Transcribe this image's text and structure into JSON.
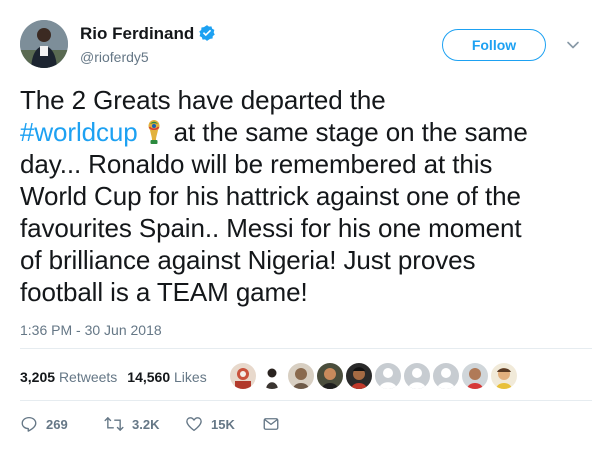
{
  "author": {
    "name": "Rio Ferdinand",
    "handle": "@rioferdy5",
    "verified": true
  },
  "follow_button": {
    "label": "Follow"
  },
  "tweet": {
    "lines": {
      "l1": "The 2 Greats have departed the",
      "l2_hashtag": "#worldcup",
      "l2_rest": "at the same stage on the same",
      "l3": "day... Ronaldo will be remembered at this",
      "l4": "World Cup for his hattrick against one of the",
      "l5": "favourites Spain.. Messi for his one moment",
      "l6": "of brilliance against Nigeria! Just proves",
      "l7": "football is a TEAM game!"
    },
    "timestamp": "1:36 PM - 30 Jun 2018"
  },
  "stats": {
    "retweets_count": "3,205",
    "retweets_label": "Retweets",
    "likes_count": "14,560",
    "likes_label": "Likes"
  },
  "actions": {
    "reply_count": "269",
    "retweet_count": "3.2K",
    "like_count": "15K"
  },
  "colors": {
    "accent": "#1da1f2",
    "muted_text": "#657786",
    "primary_text": "#14171a",
    "divider": "#e6ecf0"
  },
  "icons": {
    "verified": "verified-badge-icon",
    "caret": "chevron-down-icon",
    "hashflag": "world-cup-trophy-icon",
    "reply": "reply-icon",
    "retweet": "retweet-icon",
    "like": "heart-icon",
    "message": "envelope-icon"
  }
}
